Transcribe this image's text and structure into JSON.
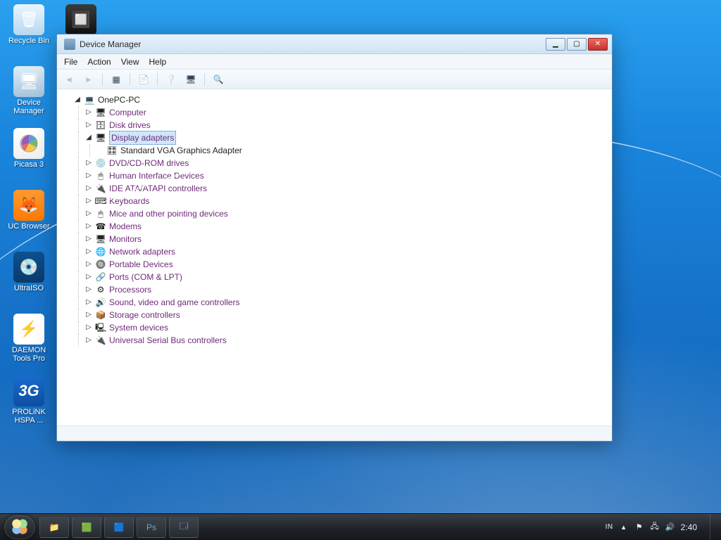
{
  "desktop_icons": [
    {
      "id": "recycle-bin",
      "label": "Recycle Bin"
    },
    {
      "id": "chip",
      "label": ""
    },
    {
      "id": "device-manager",
      "label": "Device Manager"
    },
    {
      "id": "picasa",
      "label": "Picasa 3"
    },
    {
      "id": "uc-browser",
      "label": "UC Browser"
    },
    {
      "id": "ultraiso",
      "label": "UltraISO"
    },
    {
      "id": "daemon",
      "label": "DAEMON Tools Pro"
    },
    {
      "id": "prolink",
      "label": "PROLiNK HSPA ..."
    }
  ],
  "window": {
    "title": "Device Manager",
    "menu": {
      "file": "File",
      "action": "Action",
      "view": "View",
      "help": "Help"
    },
    "tree": {
      "root": "OnePC-PC",
      "nodes": [
        {
          "label": "Computer",
          "icon": "u-mon"
        },
        {
          "label": "Disk drives",
          "icon": "u-disk"
        },
        {
          "label": "Display adapters",
          "icon": "u-disp",
          "expanded": true,
          "selected": true,
          "children": [
            {
              "label": "Standard VGA Graphics Adapter",
              "icon": "u-gpu"
            }
          ]
        },
        {
          "label": "DVD/CD-ROM drives",
          "icon": "u-dvd"
        },
        {
          "label": "Human Interface Devices",
          "icon": "u-hid"
        },
        {
          "label": "IDE ATA/ATAPI controllers",
          "icon": "u-ide"
        },
        {
          "label": "Keyboards",
          "icon": "u-kb"
        },
        {
          "label": "Mice and other pointing devices",
          "icon": "u-mouse"
        },
        {
          "label": "Modems",
          "icon": "u-modem"
        },
        {
          "label": "Monitors",
          "icon": "u-mon"
        },
        {
          "label": "Network adapters",
          "icon": "u-net"
        },
        {
          "label": "Portable Devices",
          "icon": "u-port"
        },
        {
          "label": "Ports (COM & LPT)",
          "icon": "u-com"
        },
        {
          "label": "Processors",
          "icon": "u-cpu"
        },
        {
          "label": "Sound, video and game controllers",
          "icon": "u-sound"
        },
        {
          "label": "Storage controllers",
          "icon": "u-stor"
        },
        {
          "label": "System devices",
          "icon": "u-sys"
        },
        {
          "label": "Universal Serial Bus controllers",
          "icon": "u-usb"
        }
      ]
    }
  },
  "taskbar": {
    "lang": "IN",
    "clock": "2:40"
  }
}
